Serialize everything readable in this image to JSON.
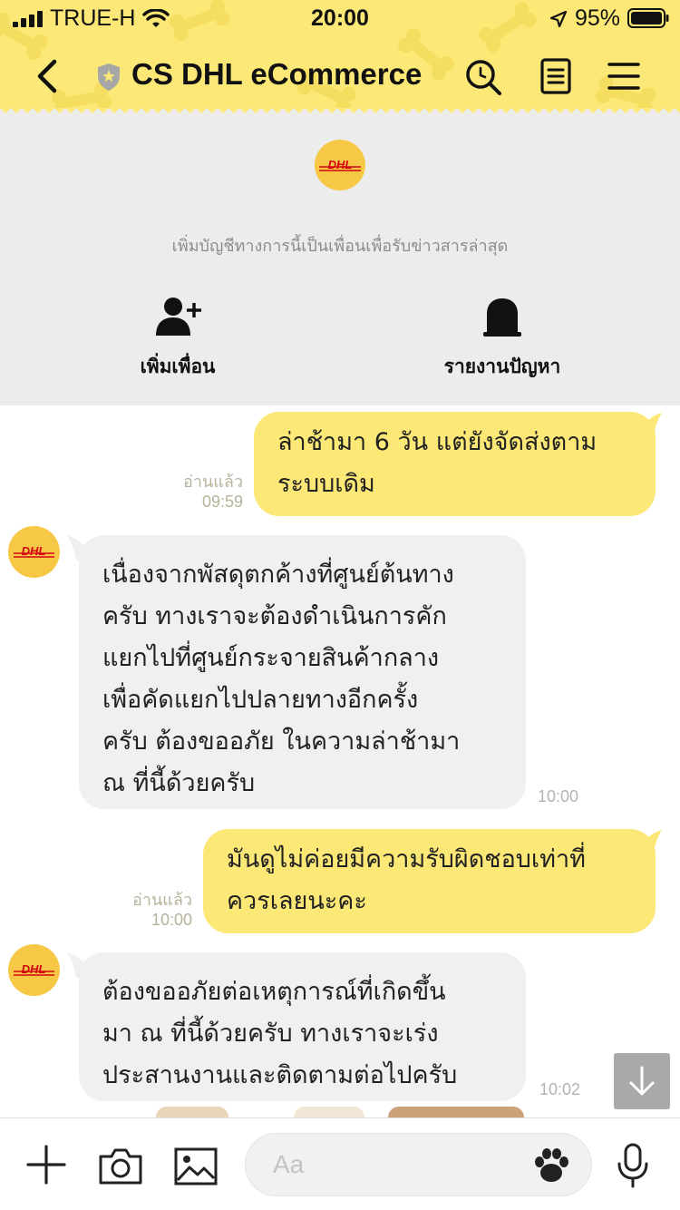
{
  "status_bar": {
    "carrier": "TRUE-H",
    "time": "20:00",
    "battery_percent": "95%"
  },
  "header": {
    "title": "CS DHL eCommerce",
    "back_icon": "chevron-left-icon",
    "verified_icon": "shield-star-icon",
    "search_icon": "search-icon",
    "notes_icon": "notes-icon",
    "menu_icon": "hamburger-menu-icon"
  },
  "account_info": {
    "logo_text": "DHL",
    "description": "เพิ่มบัญชีทางการนี้เป็นเพื่อนเพื่อรับข่าวสารล่าสุด",
    "add_friend_label": "เพิ่มเพื่อน",
    "report_label": "รายงานปัญหา"
  },
  "messages": [
    {
      "direction": "out",
      "text": "ล่าช้ามา 6 วัน แต่ยังจัดส่งตาม\nระบบเดิม",
      "read": "อ่านแล้ว",
      "time": "09:59"
    },
    {
      "direction": "in",
      "sender_logo": "DHL",
      "text": "เนื่องจากพัสดุตกค้างที่ศูนย์ต้นทาง\nครับ ทางเราจะต้องดำเนินการคัก\nแยกไปที่ศูนย์กระจายสินค้ากลาง\nเพื่อคัดแยกไปปลายทางอีกครั้ง\nครับ ต้องขออภัย ในความล่าช้ามา\nณ ที่นี้ด้วยครับ",
      "time": "10:00"
    },
    {
      "direction": "out",
      "text": "มันดูไม่ค่อยมีความรับผิดชอบเท่าที่\nควรเลยนะคะ",
      "read": "อ่านแล้ว",
      "time": "10:00"
    },
    {
      "direction": "in",
      "sender_logo": "DHL",
      "text": "ต้องขออภัยต่อเหตุการณ์ที่เกิดขึ้น\nมา ณ ที่นี้ด้วยครับ ทางเราจะเร่ง\nประสานงานและติดตามต่อไปครับ",
      "time": "10:02"
    }
  ],
  "input_bar": {
    "placeholder": "Aa",
    "plus_icon": "plus-icon",
    "camera_icon": "camera-icon",
    "image_icon": "image-icon",
    "sticker_icon": "paw-icon",
    "mic_icon": "microphone-icon"
  },
  "colors": {
    "header_bg": "#fbe876",
    "outgoing_bubble": "#fbe876",
    "incoming_bubble": "#f0f0f0",
    "info_bg": "#ececec",
    "dhl_yellow": "#f7c846",
    "dhl_red": "#d40511"
  }
}
